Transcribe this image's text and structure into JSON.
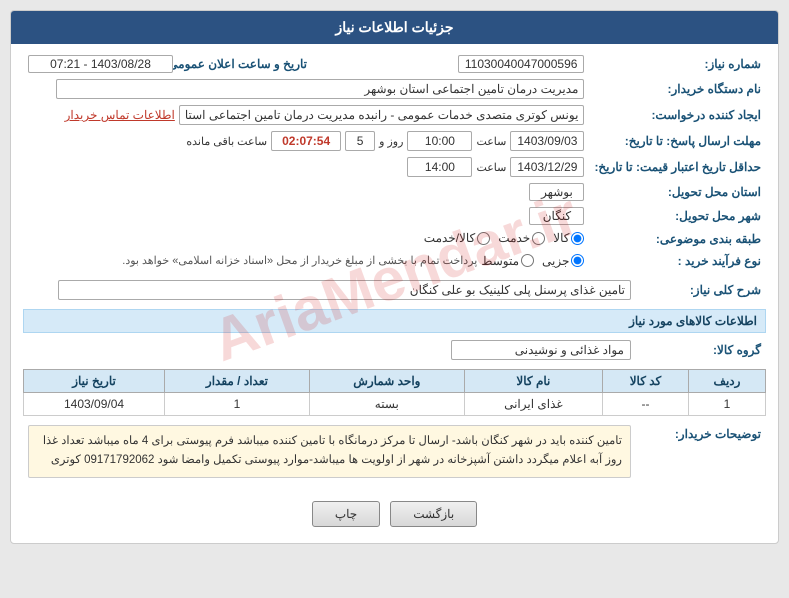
{
  "header": {
    "title": "جزئیات اطلاعات نیاز"
  },
  "fields": {
    "shomara_niaz_label": "شماره نیاز:",
    "shomara_niaz_value": "11030040047000596",
    "dastgah_kharidaar_label": "نام دستگاه خریدار:",
    "dastgah_kharidaar_value": "مدیریت درمان تامین اجتماعی استان بوشهر",
    "ijad_konande_label": "ایجاد کننده درخواست:",
    "ijad_konande_value": "یونس کوتری متصدی خدمات عمومی - رانبده مدیریت درمان تامین اجتماعی استا",
    "tamase_kharidaar_label": "اطلاعات تماس خریدار",
    "mohlat_label": "مهلت ارسال پاسخ: تا تاریخ:",
    "mohlat_date": "1403/09/03",
    "mohlat_saat": "10:00",
    "mohlat_roz": "5",
    "mohlat_baqi": "02:07:54",
    "mohlat_baqi_label": "ساعت باقی مانده",
    "jadaval_label": "حداقل تاریخ اعتبار قیمت: تا تاریخ:",
    "jadaval_date": "1403/12/29",
    "jadaval_saat": "14:00",
    "ostan_tahvil_label": "استان محل تحویل:",
    "ostan_tahvil_value": "بوشهر",
    "shahr_tahvil_label": "شهر محل تحویل:",
    "shahr_tahvil_value": "کنگان",
    "tabaghe_label": "طبقه بندی موضوعی:",
    "tabaghe_kala": "کالا",
    "tabaghe_khadamat": "خدمت",
    "tabaghe_kala_khadamat": "کالا/خدمت",
    "tabaghe_selected": "kala",
    "noe_farayand_label": "نوع فرآیند خرید :",
    "noe_jozii": "جزیی",
    "noe_motovaset": "متوسط",
    "noe_selected": "jozii",
    "noe_description": "پرداخت تمام با بخشی از مبلغ خریدار از محل «اسناد خزانه اسلامی» خواهد بود.",
    "tarikh_elan_label": "تاریخ و ساعت اعلان عمومی:",
    "tarikh_elan_value": "1403/08/28 - 07:21",
    "sharh_koli_label": "شرح کلی نیاز:",
    "sharh_koli_value": "تامین غذای پرسنل پلی کلینیک بو علی کنگان",
    "kalaha_label": "اطلاعات کالاهای مورد نیاز",
    "gorohe_kala_label": "گروه کالا:",
    "gorohe_kala_value": "مواد غذائی و نوشیدنی",
    "table_headers": [
      "ردیف",
      "کد کالا",
      "نام کالا",
      "واحد شمارش",
      "تعداد / مقدار",
      "تاریخ نیاز"
    ],
    "table_rows": [
      {
        "radif": "1",
        "kod_kala": "--",
        "name_kala": "غذای ایرانی",
        "vahed": "بسته",
        "tedad": "1",
        "tarikh": "1403/09/04"
      }
    ],
    "tozi_label": "توضیحات خریدار:",
    "tozi_value": "تامین کننده باید در شهر کنگان باشد- ارسال تا مرکز درمانگاه با تامین کننده میباشد فرم پیوستی برای 4 ماه میباشد تعداد غذا روز آبه اعلام میگردد داشتن آشپزخانه در شهر از اولویت ها میباشد-موارد پیوستی تکمیل وامضا شود 09171792062 کوتری",
    "btn_back": "بازگشت",
    "btn_print": "چاپ"
  }
}
